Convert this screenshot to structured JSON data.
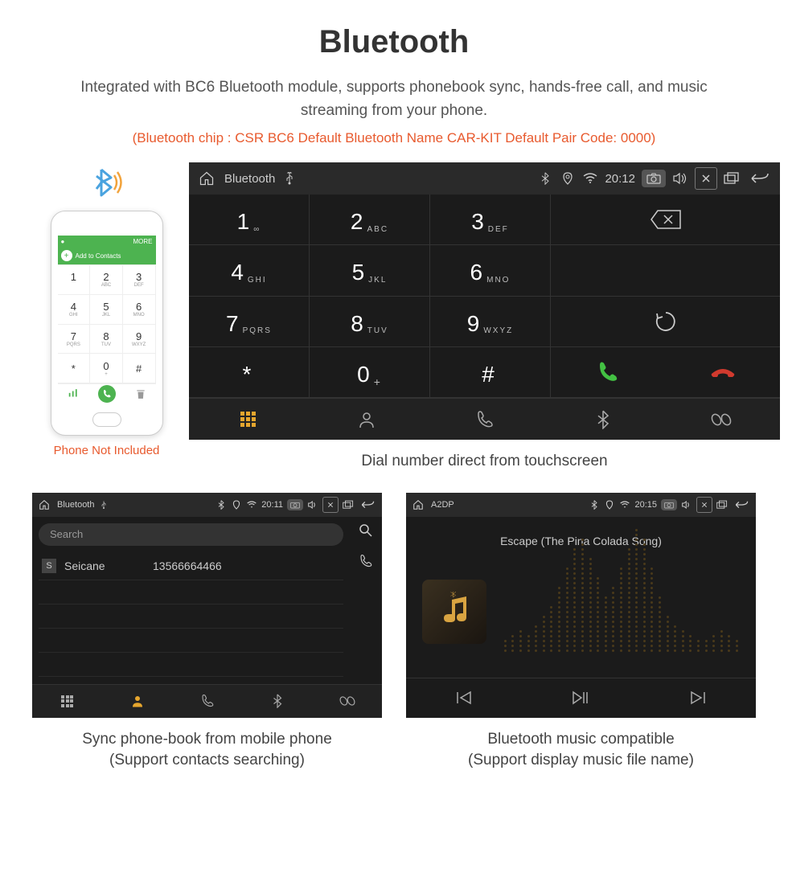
{
  "header": {
    "title": "Bluetooth",
    "subtitle": "Integrated with BC6 Bluetooth module, supports phonebook sync, hands-free call, and music streaming from your phone.",
    "spec": "(Bluetooth chip : CSR BC6    Default Bluetooth Name CAR-KIT    Default Pair Code: 0000)"
  },
  "phone_hero": {
    "caption": "Phone Not Included",
    "add_contacts": "Add to Contacts",
    "more": "MORE"
  },
  "dialer": {
    "statusbar": {
      "title": "Bluetooth",
      "time": "20:12"
    },
    "keys": [
      {
        "d": "1",
        "l": "∞"
      },
      {
        "d": "2",
        "l": "ABC"
      },
      {
        "d": "3",
        "l": "DEF"
      },
      {
        "d": "4",
        "l": "GHI"
      },
      {
        "d": "5",
        "l": "JKL"
      },
      {
        "d": "6",
        "l": "MNO"
      },
      {
        "d": "7",
        "l": "PQRS"
      },
      {
        "d": "8",
        "l": "TUV"
      },
      {
        "d": "9",
        "l": "WXYZ"
      },
      {
        "d": "*",
        "l": ""
      },
      {
        "d": "0",
        "l": "+"
      },
      {
        "d": "#",
        "l": ""
      }
    ],
    "caption": "Dial number direct from touchscreen"
  },
  "phonebook": {
    "statusbar": {
      "title": "Bluetooth",
      "time": "20:11"
    },
    "search_placeholder": "Search",
    "contact": {
      "badge": "S",
      "name": "Seicane",
      "number": "13566664466"
    },
    "caption_line1": "Sync phone-book from mobile phone",
    "caption_line2": "(Support contacts searching)"
  },
  "music": {
    "statusbar": {
      "title": "A2DP",
      "time": "20:15"
    },
    "track": "Escape (The Pina Colada Song)",
    "caption_line1": "Bluetooth music compatible",
    "caption_line2": "(Support display music file name)"
  }
}
